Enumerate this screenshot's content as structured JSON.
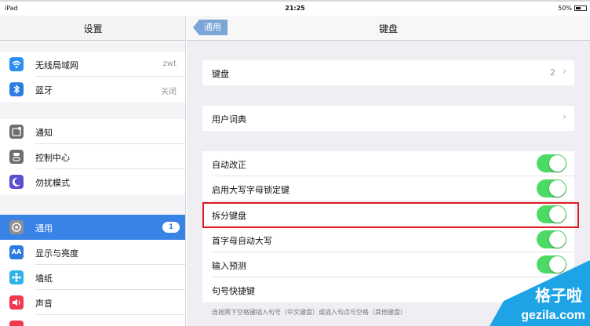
{
  "status_bar": {
    "device": "iPad",
    "time": "21:25",
    "battery": "50%"
  },
  "left_pane": {
    "title": "设置",
    "items": [
      {
        "label": "无线局域网",
        "value": "zwt",
        "icon": "wifi-icon",
        "color": "#2d8ef0"
      },
      {
        "label": "蓝牙",
        "value": "关闭",
        "icon": "bluetooth-icon",
        "color": "#2d7de0"
      },
      {
        "label": "通知",
        "value": "",
        "icon": "notifications-icon",
        "color": "#6e6e73"
      },
      {
        "label": "控制中心",
        "value": "",
        "icon": "control-center-icon",
        "color": "#6e6e73"
      },
      {
        "label": "勿扰模式",
        "value": "",
        "icon": "moon-icon",
        "color": "#5b4fcf"
      },
      {
        "label": "通用",
        "badge": "1",
        "icon": "gear-icon",
        "color": "#8e8e93"
      },
      {
        "label": "显示与亮度",
        "value": "",
        "icon": "display-icon",
        "color": "#2d7de0"
      },
      {
        "label": "墙纸",
        "value": "",
        "icon": "wallpaper-icon",
        "color": "#2fb2e8"
      },
      {
        "label": "声音",
        "value": "",
        "icon": "sound-icon",
        "color": "#f0384f"
      }
    ],
    "icon_glyphs": {
      "aa": "AA"
    }
  },
  "nav": {
    "back": "通用",
    "title": "键盘"
  },
  "cells": {
    "keyboards": {
      "label": "键盘",
      "detail": "2"
    },
    "user_dictionary": {
      "label": "用户词典"
    },
    "toggles": [
      {
        "label": "自动改正",
        "on": true
      },
      {
        "label": "启用大写字母锁定键",
        "on": true
      },
      {
        "label": "拆分键盘",
        "on": true
      },
      {
        "label": "首字母自动大写",
        "on": true
      },
      {
        "label": "输入预测",
        "on": true
      }
    ],
    "shortcut": {
      "label": "句号快捷键"
    },
    "footnote": "连按两下空格键插入句号（中文键盘）或插入句点与空格（其他键盘）"
  },
  "watermark": {
    "line1": "格子啦",
    "line2": "gezila.com"
  },
  "colors": {
    "accent": "#3a83e6",
    "toggle_on": "#4cd964",
    "highlight": "#e01b24"
  }
}
